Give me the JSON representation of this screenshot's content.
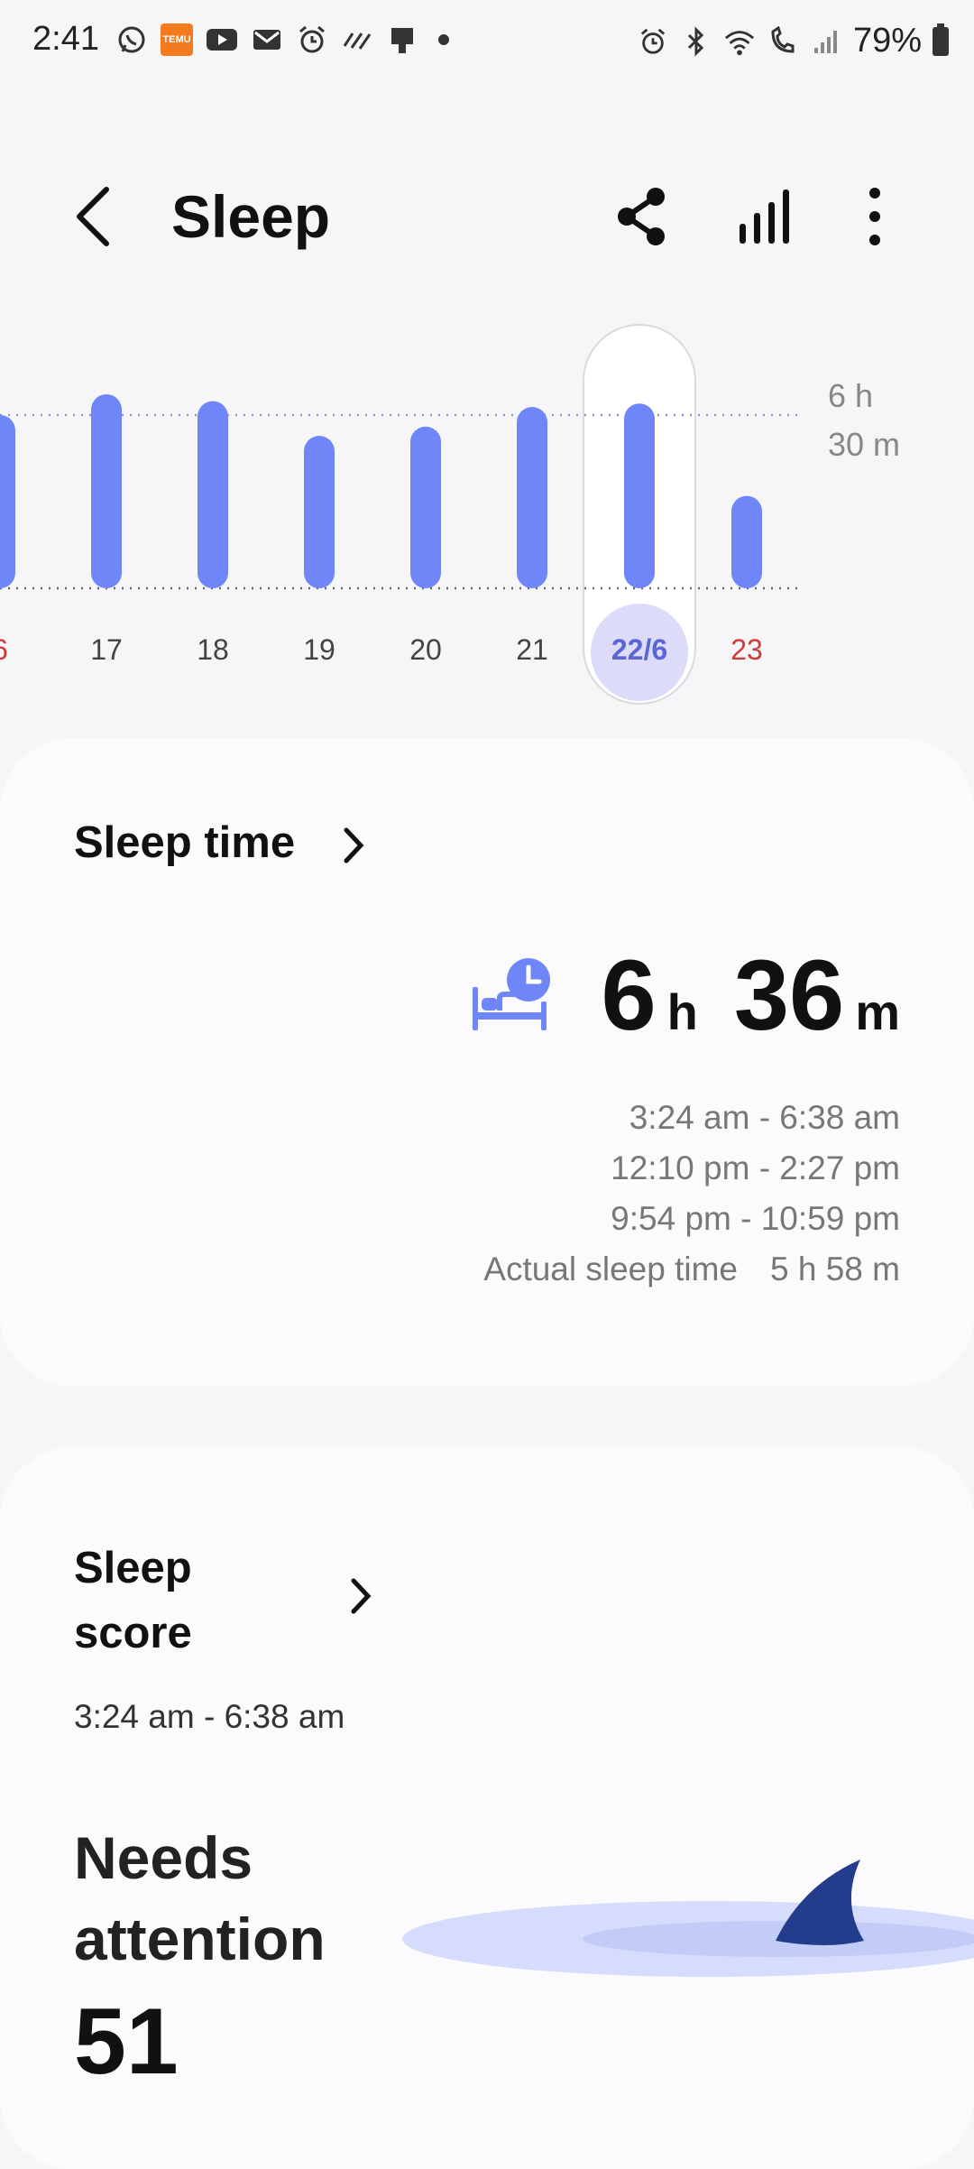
{
  "status_bar": {
    "time": "2:41",
    "temu_label": "TEMU",
    "battery_percent": "79%"
  },
  "header": {
    "title": "Sleep",
    "icons": [
      "back-arrow-icon",
      "share-icon",
      "stats-icon",
      "more-vert-icon"
    ]
  },
  "chart_data": {
    "type": "bar",
    "categories": [
      "6",
      "17",
      "18",
      "19",
      "20",
      "21",
      "22/6",
      "23"
    ],
    "values": [
      6.5,
      6.68,
      6.62,
      6.32,
      6.4,
      6.57,
      6.6,
      5.8
    ],
    "selected": "22/6",
    "reference_line": "6 h\n30 m",
    "reference_line_value": 6.5,
    "accent_color": "#6f86f8",
    "weekend_color": "#d03a3a",
    "xlabel": "",
    "ylabel": ""
  },
  "sleep_time": {
    "title": "Sleep time",
    "hours": "6",
    "hours_unit": "h",
    "minutes": "36",
    "minutes_unit": "m",
    "ranges": [
      "3:24 am - 6:38 am",
      "12:10 pm - 2:27 pm",
      "9:54 pm - 10:59 pm"
    ],
    "actual_label": "Actual sleep time",
    "actual_value": "5 h 58 m"
  },
  "sleep_score": {
    "title_line1": "Sleep",
    "title_line2": "score",
    "time_range": "3:24 am - 6:38 am",
    "status_line1": "Needs",
    "status_line2": "attention",
    "value": "51"
  }
}
